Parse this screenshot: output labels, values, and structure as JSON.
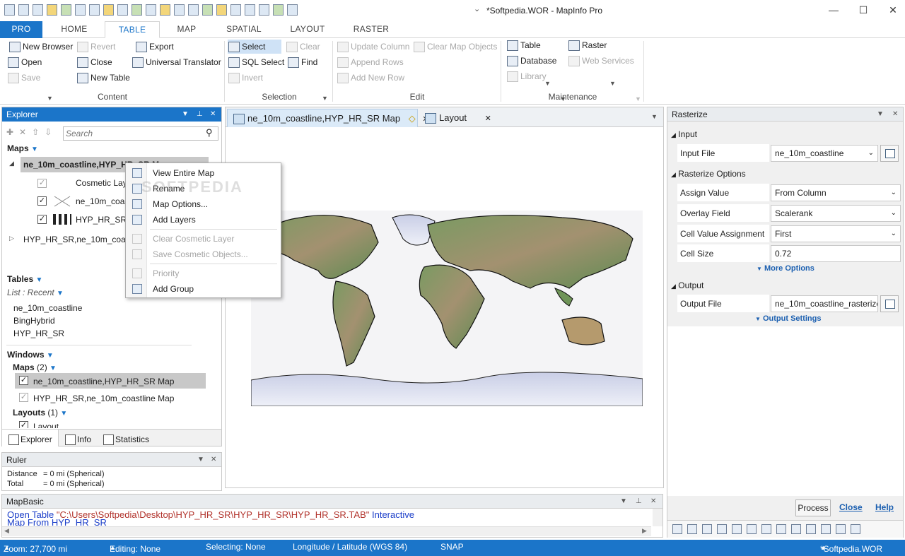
{
  "window": {
    "title": "*Softpedia.WOR - MapInfo Pro",
    "minimize": "—",
    "maximize": "☐",
    "close": "✕"
  },
  "tabs": [
    "PRO",
    "HOME",
    "TABLE",
    "MAP",
    "SPATIAL",
    "LAYOUT",
    "RASTER"
  ],
  "ribbon": {
    "content": {
      "new_browser": "New Browser",
      "revert": "Revert",
      "export": "Export",
      "open": "Open",
      "close": "Close",
      "universal_translator": "Universal Translator",
      "save": "Save",
      "new_table": "New Table",
      "label": "Content"
    },
    "selection": {
      "select": "Select",
      "clear": "Clear",
      "sql_select": "SQL Select",
      "find": "Find",
      "invert": "Invert",
      "label": "Selection"
    },
    "edit": {
      "update_column": "Update Column",
      "clear_map_objects": "Clear Map Objects",
      "append_rows": "Append Rows",
      "add_new_row": "Add New Row",
      "label": "Edit"
    },
    "maintenance": {
      "table": "Table",
      "raster": "Raster",
      "database": "Database",
      "web_services": "Web Services",
      "library": "Library",
      "label": "Maintenance"
    }
  },
  "explorer": {
    "title": "Explorer",
    "search_placeholder": "Search",
    "maps_header": "Maps",
    "map1": "ne_10m_coastline,HYP_HR_SR M",
    "layer_cosmetic": "Cosmetic Lay",
    "layer_coast": "ne_10m_coast",
    "layer_hyp": "HYP_HR_SR",
    "map2": "HYP_HR_SR,ne_10m_coastli",
    "tables_header": "Tables",
    "list_mode": "List : Recent",
    "tables": [
      "ne_10m_coastline",
      "BingHybrid",
      "HYP_HR_SR"
    ],
    "windows_header": "Windows",
    "maps_count_label": "Maps",
    "maps_count": "(2)",
    "win_map1": "ne_10m_coastline,HYP_HR_SR Map",
    "win_map2": "HYP_HR_SR,ne_10m_coastline Map",
    "layouts_label": "Layouts",
    "layouts_count": "(1)",
    "layout_item": "Layout",
    "bottom_tabs": [
      "Explorer",
      "Info",
      "Statistics"
    ]
  },
  "context_menu": {
    "items": [
      "View Entire Map",
      "Rename",
      "Map Options...",
      "Add Layers",
      "Clear Cosmetic Layer",
      "Save Cosmetic Objects...",
      "Priority",
      "Add Group"
    ]
  },
  "document_tabs": {
    "map_tab": "ne_10m_coastline,HYP_HR_SR Map",
    "layout_tab": "Layout"
  },
  "watermark": "SOFTPEDIA",
  "rasterize": {
    "title": "Rasterize",
    "input_section": "Input",
    "input_file_label": "Input File",
    "input_file": "ne_10m_coastline",
    "options_section": "Rasterize Options",
    "assign_value_label": "Assign Value",
    "assign_value": "From Column",
    "overlay_field_label": "Overlay Field",
    "overlay_field": "Scalerank",
    "cell_value_label": "Cell Value Assignment",
    "cell_value": "First",
    "cell_size_label": "Cell Size",
    "cell_size": "0.72",
    "more_options": "More Options",
    "output_section": "Output",
    "output_file_label": "Output File",
    "output_file": "ne_10m_coastline_rasterize",
    "output_settings": "Output Settings",
    "process": "Process",
    "close": "Close",
    "help": "Help"
  },
  "ruler": {
    "title": "Ruler",
    "distance_label": "Distance",
    "distance_value": "= 0 mi (Spherical)",
    "total_label": "Total",
    "total_value": "= 0 mi (Spherical)"
  },
  "mapbasic": {
    "title": "MapBasic",
    "line1_kw": "Open Table",
    "line1_str": "\"C:\\Users\\Softpedia\\Desktop\\HYP_HR_SR\\HYP_HR_SR\\HYP_HR_SR.TAB\"",
    "line1_kw2": "Interactive",
    "line2": "Map From HYP_HR_SR"
  },
  "status": {
    "zoom": "Zoom: 27,700 mi",
    "editing": "Editing: None",
    "selecting": "Selecting: None",
    "projection": "Longitude / Latitude (WGS 84)",
    "snap": "SNAP",
    "workspace": "*Softpedia.WOR"
  },
  "colors": {
    "accent": "#1b75c9",
    "map_ocean": "#ffffff",
    "land_low": "#5b8a4a",
    "land_high": "#a08866",
    "ice": "#dfe3f1"
  }
}
